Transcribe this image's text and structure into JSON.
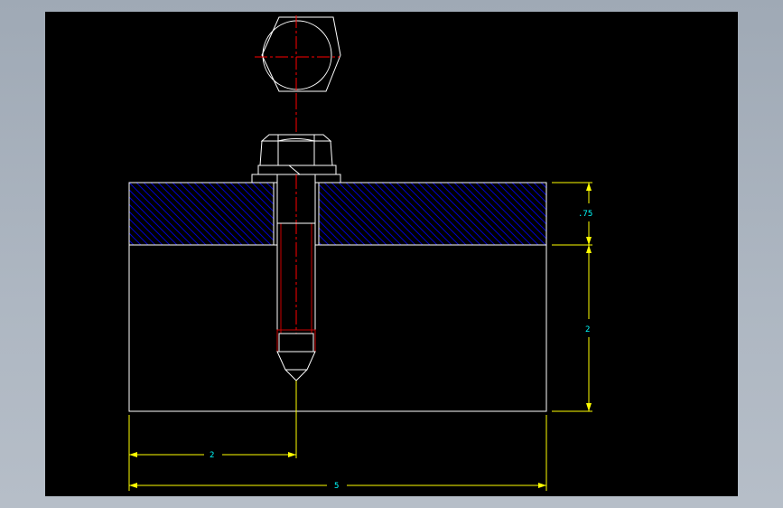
{
  "drawing": {
    "background_color": "#000000",
    "line_color": "#ffffff",
    "centerline_color": "#ff0000",
    "hatch_color": "#0000cc",
    "thread_color": "#cc0000",
    "dimension_line_color": "#ffff00",
    "dimension_text_color": "#00ffff",
    "dimensions": {
      "plate_thickness": ".75",
      "block_height": "2",
      "bolt_offset": "2",
      "overall_width": "5"
    }
  }
}
